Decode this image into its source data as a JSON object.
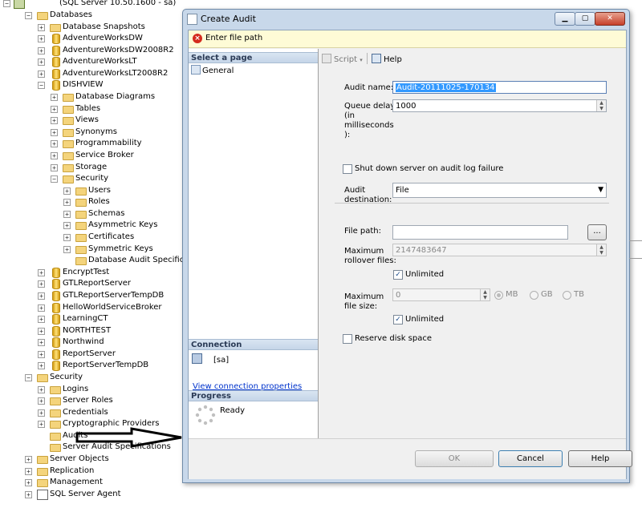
{
  "tree": {
    "server": "(SQL Server 10.50.1600 - sa)",
    "items": [
      {
        "label": "Databases",
        "depth": 0,
        "icon": "folder-icon",
        "toggle": "−"
      },
      {
        "label": "Database Snapshots",
        "depth": 1,
        "icon": "folder-icon",
        "toggle": "+"
      },
      {
        "label": "AdventureWorksDW",
        "depth": 1,
        "icon": "database-icon",
        "toggle": "+"
      },
      {
        "label": "AdventureWorksDW2008R2",
        "depth": 1,
        "icon": "database-icon",
        "toggle": "+"
      },
      {
        "label": "AdventureWorksLT",
        "depth": 1,
        "icon": "database-icon",
        "toggle": "+"
      },
      {
        "label": "AdventureWorksLT2008R2",
        "depth": 1,
        "icon": "database-icon",
        "toggle": "+"
      },
      {
        "label": "DISHVIEW",
        "depth": 1,
        "icon": "database-icon",
        "toggle": "−"
      },
      {
        "label": "Database Diagrams",
        "depth": 2,
        "icon": "folder-icon",
        "toggle": "+"
      },
      {
        "label": "Tables",
        "depth": 2,
        "icon": "folder-icon",
        "toggle": "+"
      },
      {
        "label": "Views",
        "depth": 2,
        "icon": "folder-icon",
        "toggle": "+"
      },
      {
        "label": "Synonyms",
        "depth": 2,
        "icon": "folder-icon",
        "toggle": "+"
      },
      {
        "label": "Programmability",
        "depth": 2,
        "icon": "folder-icon",
        "toggle": "+"
      },
      {
        "label": "Service Broker",
        "depth": 2,
        "icon": "folder-icon",
        "toggle": "+"
      },
      {
        "label": "Storage",
        "depth": 2,
        "icon": "folder-icon",
        "toggle": "+"
      },
      {
        "label": "Security",
        "depth": 2,
        "icon": "folder-icon",
        "toggle": "−"
      },
      {
        "label": "Users",
        "depth": 3,
        "icon": "folder-icon",
        "toggle": "+"
      },
      {
        "label": "Roles",
        "depth": 3,
        "icon": "folder-icon",
        "toggle": "+"
      },
      {
        "label": "Schemas",
        "depth": 3,
        "icon": "folder-icon",
        "toggle": "+"
      },
      {
        "label": "Asymmetric Keys",
        "depth": 3,
        "icon": "folder-icon",
        "toggle": "+"
      },
      {
        "label": "Certificates",
        "depth": 3,
        "icon": "folder-icon",
        "toggle": "+"
      },
      {
        "label": "Symmetric Keys",
        "depth": 3,
        "icon": "folder-icon",
        "toggle": "+"
      },
      {
        "label": "Database Audit Specifications",
        "depth": 3,
        "icon": "folder-icon",
        "toggle": ""
      },
      {
        "label": "EncryptTest",
        "depth": 1,
        "icon": "database-icon",
        "toggle": "+"
      },
      {
        "label": "GTLReportServer",
        "depth": 1,
        "icon": "database-icon",
        "toggle": "+"
      },
      {
        "label": "GTLReportServerTempDB",
        "depth": 1,
        "icon": "database-icon",
        "toggle": "+"
      },
      {
        "label": "HelloWorldServiceBroker",
        "depth": 1,
        "icon": "database-icon",
        "toggle": "+"
      },
      {
        "label": "LearningCT",
        "depth": 1,
        "icon": "database-icon",
        "toggle": "+"
      },
      {
        "label": "NORTHTEST",
        "depth": 1,
        "icon": "database-icon",
        "toggle": "+"
      },
      {
        "label": "Northwind",
        "depth": 1,
        "icon": "database-icon",
        "toggle": "+"
      },
      {
        "label": "ReportServer",
        "depth": 1,
        "icon": "database-icon",
        "toggle": "+"
      },
      {
        "label": "ReportServerTempDB",
        "depth": 1,
        "icon": "database-icon",
        "toggle": "+"
      },
      {
        "label": "Security",
        "depth": 0,
        "icon": "folder-icon",
        "toggle": "−"
      },
      {
        "label": "Logins",
        "depth": 1,
        "icon": "folder-icon",
        "toggle": "+"
      },
      {
        "label": "Server Roles",
        "depth": 1,
        "icon": "folder-icon",
        "toggle": "+"
      },
      {
        "label": "Credentials",
        "depth": 1,
        "icon": "folder-icon",
        "toggle": "+"
      },
      {
        "label": "Cryptographic Providers",
        "depth": 1,
        "icon": "folder-icon",
        "toggle": "+"
      },
      {
        "label": "Audits",
        "depth": 1,
        "icon": "folder-icon",
        "toggle": ""
      },
      {
        "label": "Server Audit Specifications",
        "depth": 1,
        "icon": "folder-icon",
        "toggle": ""
      },
      {
        "label": "Server Objects",
        "depth": 0,
        "icon": "folder-icon",
        "toggle": "+"
      },
      {
        "label": "Replication",
        "depth": 0,
        "icon": "folder-icon",
        "toggle": "+"
      },
      {
        "label": "Management",
        "depth": 0,
        "icon": "folder-icon",
        "toggle": "+"
      },
      {
        "label": "SQL Server Agent",
        "depth": 0,
        "icon": "agent-icon",
        "toggle": "+"
      }
    ]
  },
  "dialog": {
    "title": "Create Audit",
    "error": "Enter file path",
    "select_page_header": "Select a page",
    "pages": [
      "General"
    ],
    "connection_header": "Connection",
    "connection_server": "[sa]",
    "connection_link": "View connection properties",
    "progress_header": "Progress",
    "progress_status": "Ready",
    "toolbar": {
      "script": "Script",
      "help": "Help"
    },
    "form": {
      "audit_name_label": "Audit name:",
      "audit_name_value": "Audit-20111025-170134",
      "queue_delay_label_1": "Queue delay",
      "queue_delay_label_2": "(in",
      "queue_delay_label_3": "milliseconds",
      "queue_delay_label_4": "):",
      "queue_delay_value": "1000",
      "shutdown_label": "Shut down server on audit log failure",
      "destination_label_1": "Audit",
      "destination_label_2": "destination:",
      "destination_value": "File",
      "file_path_label": "File path:",
      "file_path_value": "",
      "browse_label": "...",
      "max_rollover_label_1": "Maximum",
      "max_rollover_label_2": "rollover files:",
      "max_rollover_value": "2147483647",
      "unlimited_label_1": "Unlimited",
      "max_file_size_label_1": "Maximum",
      "max_file_size_label_2": "file size:",
      "max_file_size_value": "0",
      "mb_label": "MB",
      "gb_label": "GB",
      "tb_label": "TB",
      "unlimited_label_2": "Unlimited",
      "reserve_label": "Reserve disk space"
    },
    "buttons": {
      "ok": "OK",
      "cancel": "Cancel",
      "help": "Help"
    }
  },
  "colors": {
    "selection": "#3399ff",
    "error_bar": "#fefbd6",
    "link": "#0033cc"
  }
}
